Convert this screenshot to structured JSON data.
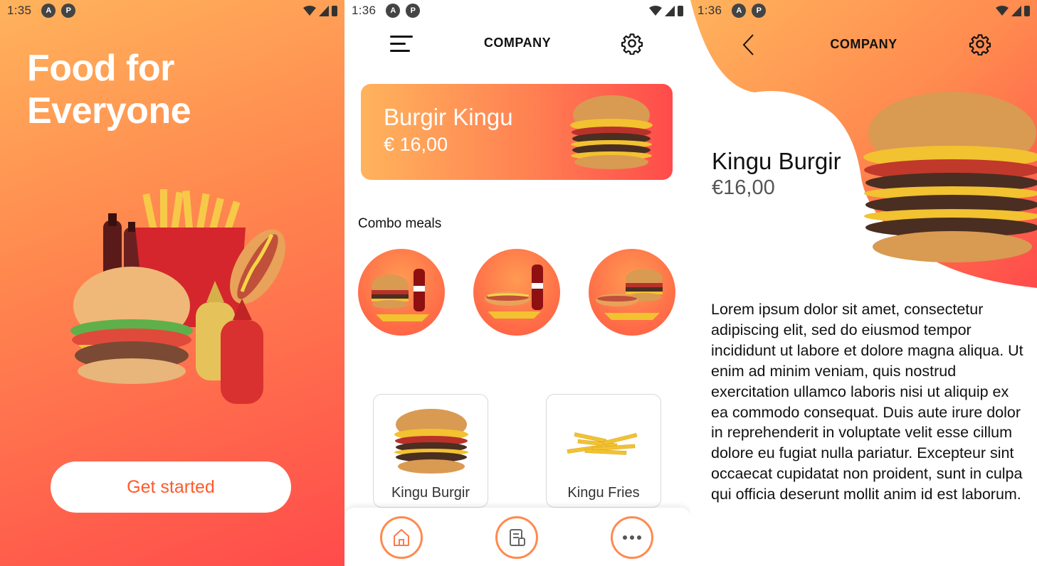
{
  "screen1": {
    "status": {
      "time": "1:35"
    },
    "title": "Food for Everyone",
    "cta_label": "Get started"
  },
  "screen2": {
    "status": {
      "time": "1:36"
    },
    "title": "COMPANY",
    "promo": {
      "name": "Burgir Kingu",
      "price": "€ 16,00"
    },
    "section_label": "Combo meals",
    "cards": [
      {
        "label": "Kingu Burgir"
      },
      {
        "label": "Kingu Fries"
      }
    ]
  },
  "screen3": {
    "status": {
      "time": "1:36"
    },
    "title": "COMPANY",
    "product_name": "Kingu Burgir",
    "product_price": "€16,00",
    "description": "Lorem ipsum dolor sit amet, consectetur adipiscing elit, sed do eiusmod tempor incididunt ut labore et dolore magna aliqua. Ut enim ad minim veniam, quis nostrud exercitation ullamco laboris nisi ut aliquip ex ea commodo consequat. Duis aute irure dolor in reprehenderit in voluptate velit esse cillum dolore eu fugiat nulla pariatur. Excepteur sint occaecat cupidatat non proident, sunt in culpa qui officia deserunt mollit anim id est laborum."
  },
  "colors": {
    "accent": "#ff5a2a",
    "gradient_start": "#ffb35c",
    "gradient_end": "#ff4b4b"
  },
  "icons": [
    "menu-icon",
    "gear-icon",
    "back-icon",
    "home-icon",
    "orders-icon",
    "more-icon"
  ]
}
